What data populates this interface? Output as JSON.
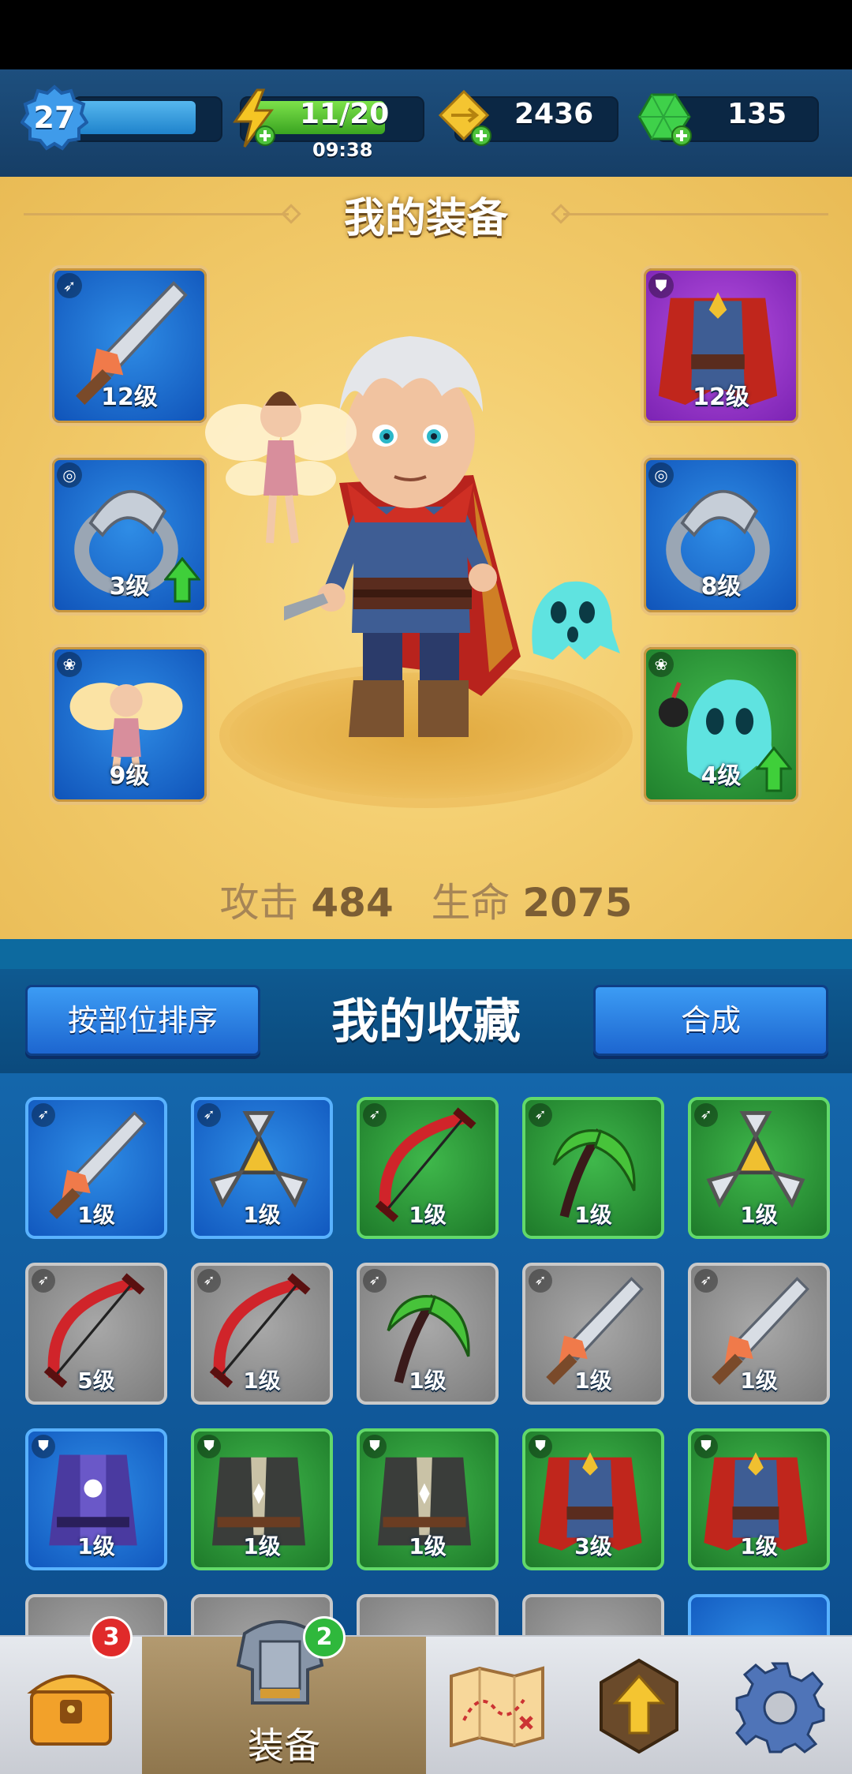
{
  "resources": {
    "player_level": "27",
    "energy_text": "11/20",
    "energy_timer": "09:38",
    "gold": "2436",
    "gems": "135"
  },
  "equipment": {
    "title": "我的装备",
    "slots": [
      {
        "item": "sword",
        "level": "12级",
        "rarity": "blue",
        "type_icon": "bow-icon"
      },
      {
        "item": "ring",
        "level": "3级",
        "rarity": "blue",
        "type_icon": "ring-icon",
        "upgrade": true
      },
      {
        "item": "fairy",
        "level": "9级",
        "rarity": "blue",
        "type_icon": "paw-icon"
      },
      {
        "item": "cape-armor",
        "level": "12级",
        "rarity": "purple",
        "type_icon": "armor-icon"
      },
      {
        "item": "ring",
        "level": "8级",
        "rarity": "blue",
        "type_icon": "ring-icon"
      },
      {
        "item": "ghost-pet",
        "level": "4级",
        "rarity": "green",
        "type_icon": "paw-icon",
        "upgrade": true
      }
    ],
    "stats": {
      "attack_label": "攻击",
      "attack_value": "484",
      "hp_label": "生命",
      "hp_value": "2075"
    }
  },
  "collection": {
    "sort_button": "按部位排序",
    "title": "我的收藏",
    "craft_button": "合成",
    "items": [
      {
        "item": "sword",
        "level": "1级",
        "rarity": "blue"
      },
      {
        "item": "shuriken",
        "level": "1级",
        "rarity": "blue"
      },
      {
        "item": "bow",
        "level": "1级",
        "rarity": "green"
      },
      {
        "item": "scythe",
        "level": "1级",
        "rarity": "green"
      },
      {
        "item": "shuriken",
        "level": "1级",
        "rarity": "green"
      },
      {
        "item": "bow",
        "level": "5级",
        "rarity": "gray"
      },
      {
        "item": "bow",
        "level": "1级",
        "rarity": "gray"
      },
      {
        "item": "scythe",
        "level": "1级",
        "rarity": "gray"
      },
      {
        "item": "sword",
        "level": "1级",
        "rarity": "gray"
      },
      {
        "item": "sword",
        "level": "1级",
        "rarity": "gray"
      },
      {
        "item": "robe-armor",
        "level": "1级",
        "rarity": "blue"
      },
      {
        "item": "vest-armor",
        "level": "1级",
        "rarity": "green"
      },
      {
        "item": "vest-armor",
        "level": "1级",
        "rarity": "green"
      },
      {
        "item": "cape-armor",
        "level": "3级",
        "rarity": "green"
      },
      {
        "item": "cape-armor",
        "level": "1级",
        "rarity": "green"
      }
    ]
  },
  "nav": {
    "equip_label": "装备",
    "chest_badge": "3",
    "equip_badge": "2"
  },
  "colors": {
    "rarity_blue": "#1f74d6",
    "rarity_green": "#2f9a3a",
    "rarity_purple": "#9a38cc",
    "rarity_gray": "#8e8e8e",
    "panel_gold": "#f3cd6e"
  }
}
